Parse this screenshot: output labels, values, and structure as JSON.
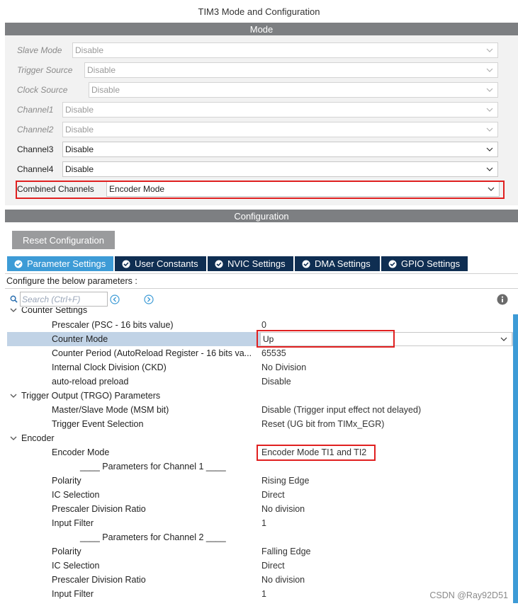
{
  "window": {
    "title": "TIM3 Mode and Configuration"
  },
  "mode": {
    "header": "Mode",
    "rows": [
      {
        "label": "Slave Mode",
        "value": "Disable",
        "enabled": false
      },
      {
        "label": "Trigger Source",
        "value": "Disable",
        "enabled": false
      },
      {
        "label": "Clock Source",
        "value": "Disable",
        "enabled": false
      },
      {
        "label": "Channel1",
        "value": "Disable",
        "enabled": false
      },
      {
        "label": "Channel2",
        "value": "Disable",
        "enabled": false
      },
      {
        "label": "Channel3",
        "value": "Disable",
        "enabled": true
      },
      {
        "label": "Channel4",
        "value": "Disable",
        "enabled": true
      },
      {
        "label": "Combined Channels",
        "value": "Encoder Mode",
        "enabled": true
      }
    ]
  },
  "configuration": {
    "header": "Configuration",
    "reset_label": "Reset Configuration",
    "tabs": [
      {
        "label": "Parameter Settings",
        "active": true
      },
      {
        "label": "User Constants",
        "active": false
      },
      {
        "label": "NVIC Settings",
        "active": false
      },
      {
        "label": "DMA Settings",
        "active": false
      },
      {
        "label": "GPIO Settings",
        "active": false
      }
    ],
    "configure_text": "Configure the below parameters :",
    "search_placeholder": "Search (Ctrl+F)",
    "groups": {
      "counter": "Counter Settings",
      "trgo": "Trigger Output (TRGO) Parameters",
      "encoder": "Encoder"
    },
    "params": {
      "prescaler": {
        "name": "Prescaler (PSC - 16 bits value)",
        "value": "0"
      },
      "counter_mode": {
        "name": "Counter Mode",
        "value": "Up"
      },
      "counter_period": {
        "name": "Counter Period (AutoReload Register - 16 bits va...",
        "value": "65535"
      },
      "ckd": {
        "name": "Internal Clock Division (CKD)",
        "value": "No Division"
      },
      "arpe": {
        "name": "auto-reload preload",
        "value": "Disable"
      },
      "msm": {
        "name": "Master/Slave Mode (MSM bit)",
        "value": "Disable (Trigger input effect not delayed)"
      },
      "trgo_event": {
        "name": "Trigger Event Selection",
        "value": "Reset (UG bit from TIMx_EGR)"
      },
      "encoder_mode": {
        "name": "Encoder Mode",
        "value": "Encoder Mode TI1 and TI2"
      },
      "ch1_header": "____ Parameters for Channel 1 ____",
      "ch1_polarity": {
        "name": "Polarity",
        "value": "Rising Edge"
      },
      "ch1_ic": {
        "name": "IC Selection",
        "value": "Direct"
      },
      "ch1_psc": {
        "name": "Prescaler Division Ratio",
        "value": "No division"
      },
      "ch1_filter": {
        "name": "Input Filter",
        "value": "1"
      },
      "ch2_header": "____ Parameters for Channel 2 ____",
      "ch2_polarity": {
        "name": "Polarity",
        "value": "Falling Edge"
      },
      "ch2_ic": {
        "name": "IC Selection",
        "value": "Direct"
      },
      "ch2_psc": {
        "name": "Prescaler Division Ratio",
        "value": "No division"
      },
      "ch2_filter": {
        "name": "Input Filter",
        "value": "1"
      }
    }
  },
  "watermark": "CSDN @Ray92D51",
  "colors": {
    "tab_active": "#3d9bd6",
    "tab": "#0f2e52",
    "highlight": "#e02020",
    "section_bar": "#7d7f82"
  }
}
